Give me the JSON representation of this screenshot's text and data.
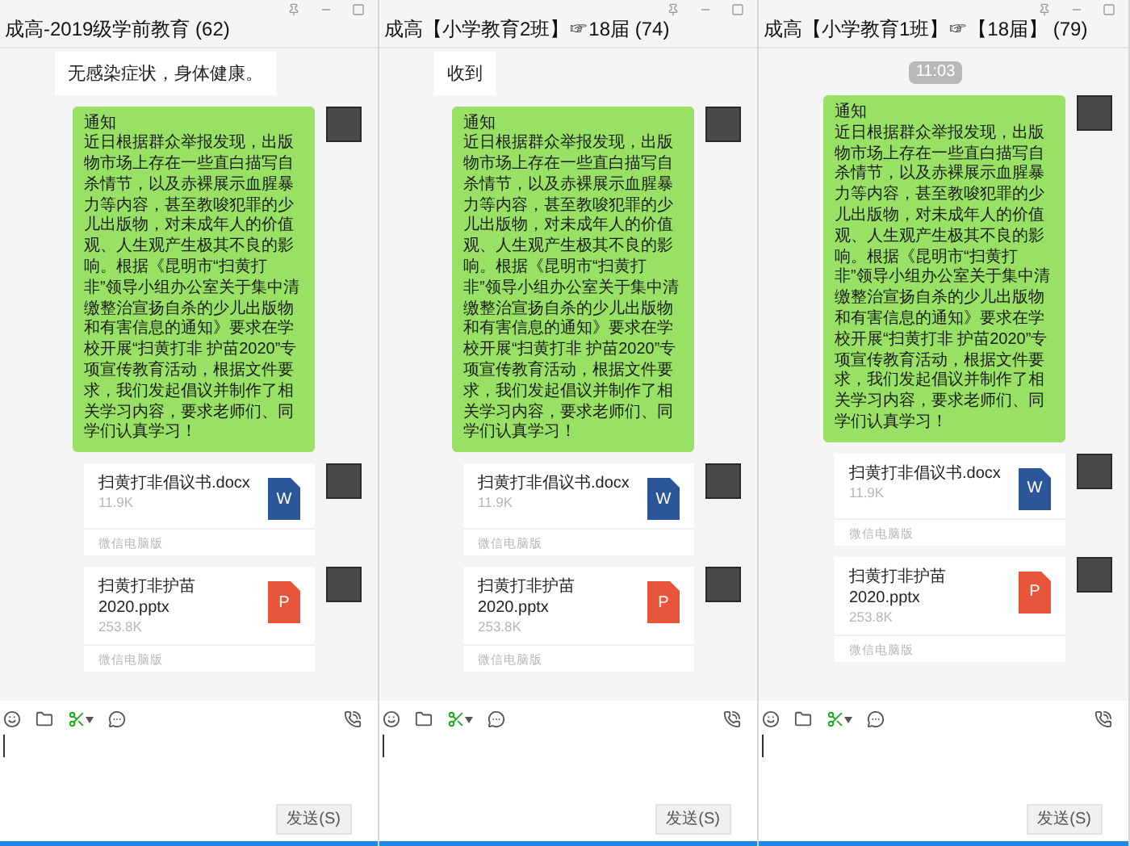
{
  "chats": [
    {
      "title": "成高-2019级学前教育 (62)",
      "top_item": {
        "kind": "incoming",
        "text": "无感染症状，身体健康。"
      },
      "messages": [
        {
          "kind": "text",
          "heading": "通知",
          "text": "近日根据群众举报发现，出版物市场上存在一些直白描写自杀情节，以及赤裸展示血腥暴力等内容，甚至教唆犯罪的少儿出版物，对未成年人的价值观、人生观产生极其不良的影响。根据《昆明市“扫黄打非”领导小组办公室关于集中清缴整治宣扬自杀的少儿出版物和有害信息的通知》要求在学校开展“扫黄打非 护苗2020”专项宣传教育活动，根据文件要求，我们发起倡议并制作了相关学习内容，要求老师们、同学们认真学习！"
        },
        {
          "kind": "word_file",
          "file_name": "扫黄打非倡议书.docx",
          "size": "11.9K",
          "file_letter": "W",
          "source": "微信电脑版"
        },
        {
          "kind": "powerpoint_file",
          "file_name": "扫黄打非护苗2020.pptx",
          "size": "253.8K",
          "file_letter": "P",
          "source": "微信电脑版"
        }
      ],
      "send_button": "发送(S)"
    },
    {
      "title": "成高【小学教育2班】☞18届 (74)",
      "top_item": {
        "kind": "incoming",
        "text": "收到"
      },
      "messages": [
        {
          "kind": "text",
          "heading": "通知",
          "text": "近日根据群众举报发现，出版物市场上存在一些直白描写自杀情节，以及赤裸展示血腥暴力等内容，甚至教唆犯罪的少儿出版物，对未成年人的价值观、人生观产生极其不良的影响。根据《昆明市“扫黄打非”领导小组办公室关于集中清缴整治宣扬自杀的少儿出版物和有害信息的通知》要求在学校开展“扫黄打非 护苗2020”专项宣传教育活动，根据文件要求，我们发起倡议并制作了相关学习内容，要求老师们、同学们认真学习！"
        },
        {
          "kind": "word_file",
          "file_name": "扫黄打非倡议书.docx",
          "size": "11.9K",
          "file_letter": "W",
          "source": "微信电脑版"
        },
        {
          "kind": "powerpoint_file",
          "file_name": "扫黄打非护苗2020.pptx",
          "size": "253.8K",
          "file_letter": "P",
          "source": "微信电脑版"
        }
      ],
      "send_button": "发送(S)"
    },
    {
      "title": "成高【小学教育1班】☞【18届】 (79)",
      "top_item": {
        "kind": "timestamp",
        "text": "11:03"
      },
      "messages": [
        {
          "kind": "text",
          "heading": "通知",
          "text": "近日根据群众举报发现，出版物市场上存在一些直白描写自杀情节，以及赤裸展示血腥暴力等内容，甚至教唆犯罪的少儿出版物，对未成年人的价值观、人生观产生极其不良的影响。根据《昆明市“扫黄打非”领导小组办公室关于集中清缴整治宣扬自杀的少儿出版物和有害信息的通知》要求在学校开展“扫黄打非 护苗2020”专项宣传教育活动，根据文件要求，我们发起倡议并制作了相关学习内容，要求老师们、同学们认真学习！"
        },
        {
          "kind": "word_file",
          "file_name": "扫黄打非倡议书.docx",
          "size": "11.9K",
          "file_letter": "W",
          "source": "微信电脑版"
        },
        {
          "kind": "powerpoint_file",
          "file_name": "扫黄打非护苗2020.pptx",
          "size": "253.8K",
          "file_letter": "P",
          "source": "微信电脑版"
        }
      ],
      "send_button": "发送(S)"
    }
  ]
}
